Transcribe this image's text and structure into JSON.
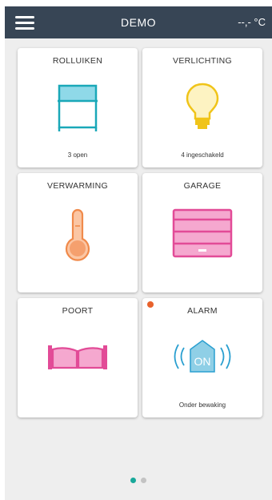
{
  "header": {
    "title": "DEMO",
    "temperature": "--,- °C",
    "menu_icon": "hamburger-menu-icon"
  },
  "tiles": [
    {
      "title": "ROLLUIKEN",
      "status": "3 open",
      "icon": "blinds-icon",
      "color": "#1aa8b8"
    },
    {
      "title": "VERLICHTING",
      "status": "4 ingeschakeld",
      "icon": "lightbulb-icon",
      "color": "#f0c419"
    },
    {
      "title": "VERWARMING",
      "status": "",
      "icon": "thermometer-icon",
      "color": "#f08a4b"
    },
    {
      "title": "GARAGE",
      "status": "",
      "icon": "garage-door-icon",
      "color": "#e24b97"
    },
    {
      "title": "POORT",
      "status": "",
      "icon": "gate-icon",
      "color": "#e24b97"
    },
    {
      "title": "ALARM",
      "status": "Onder bewaking",
      "icon": "alarm-on-icon",
      "color": "#2a9fd0",
      "alarm_badge": "ON",
      "alert_dot_color": "#e8622c"
    }
  ],
  "pagination": {
    "pages": 2,
    "current": 1
  }
}
